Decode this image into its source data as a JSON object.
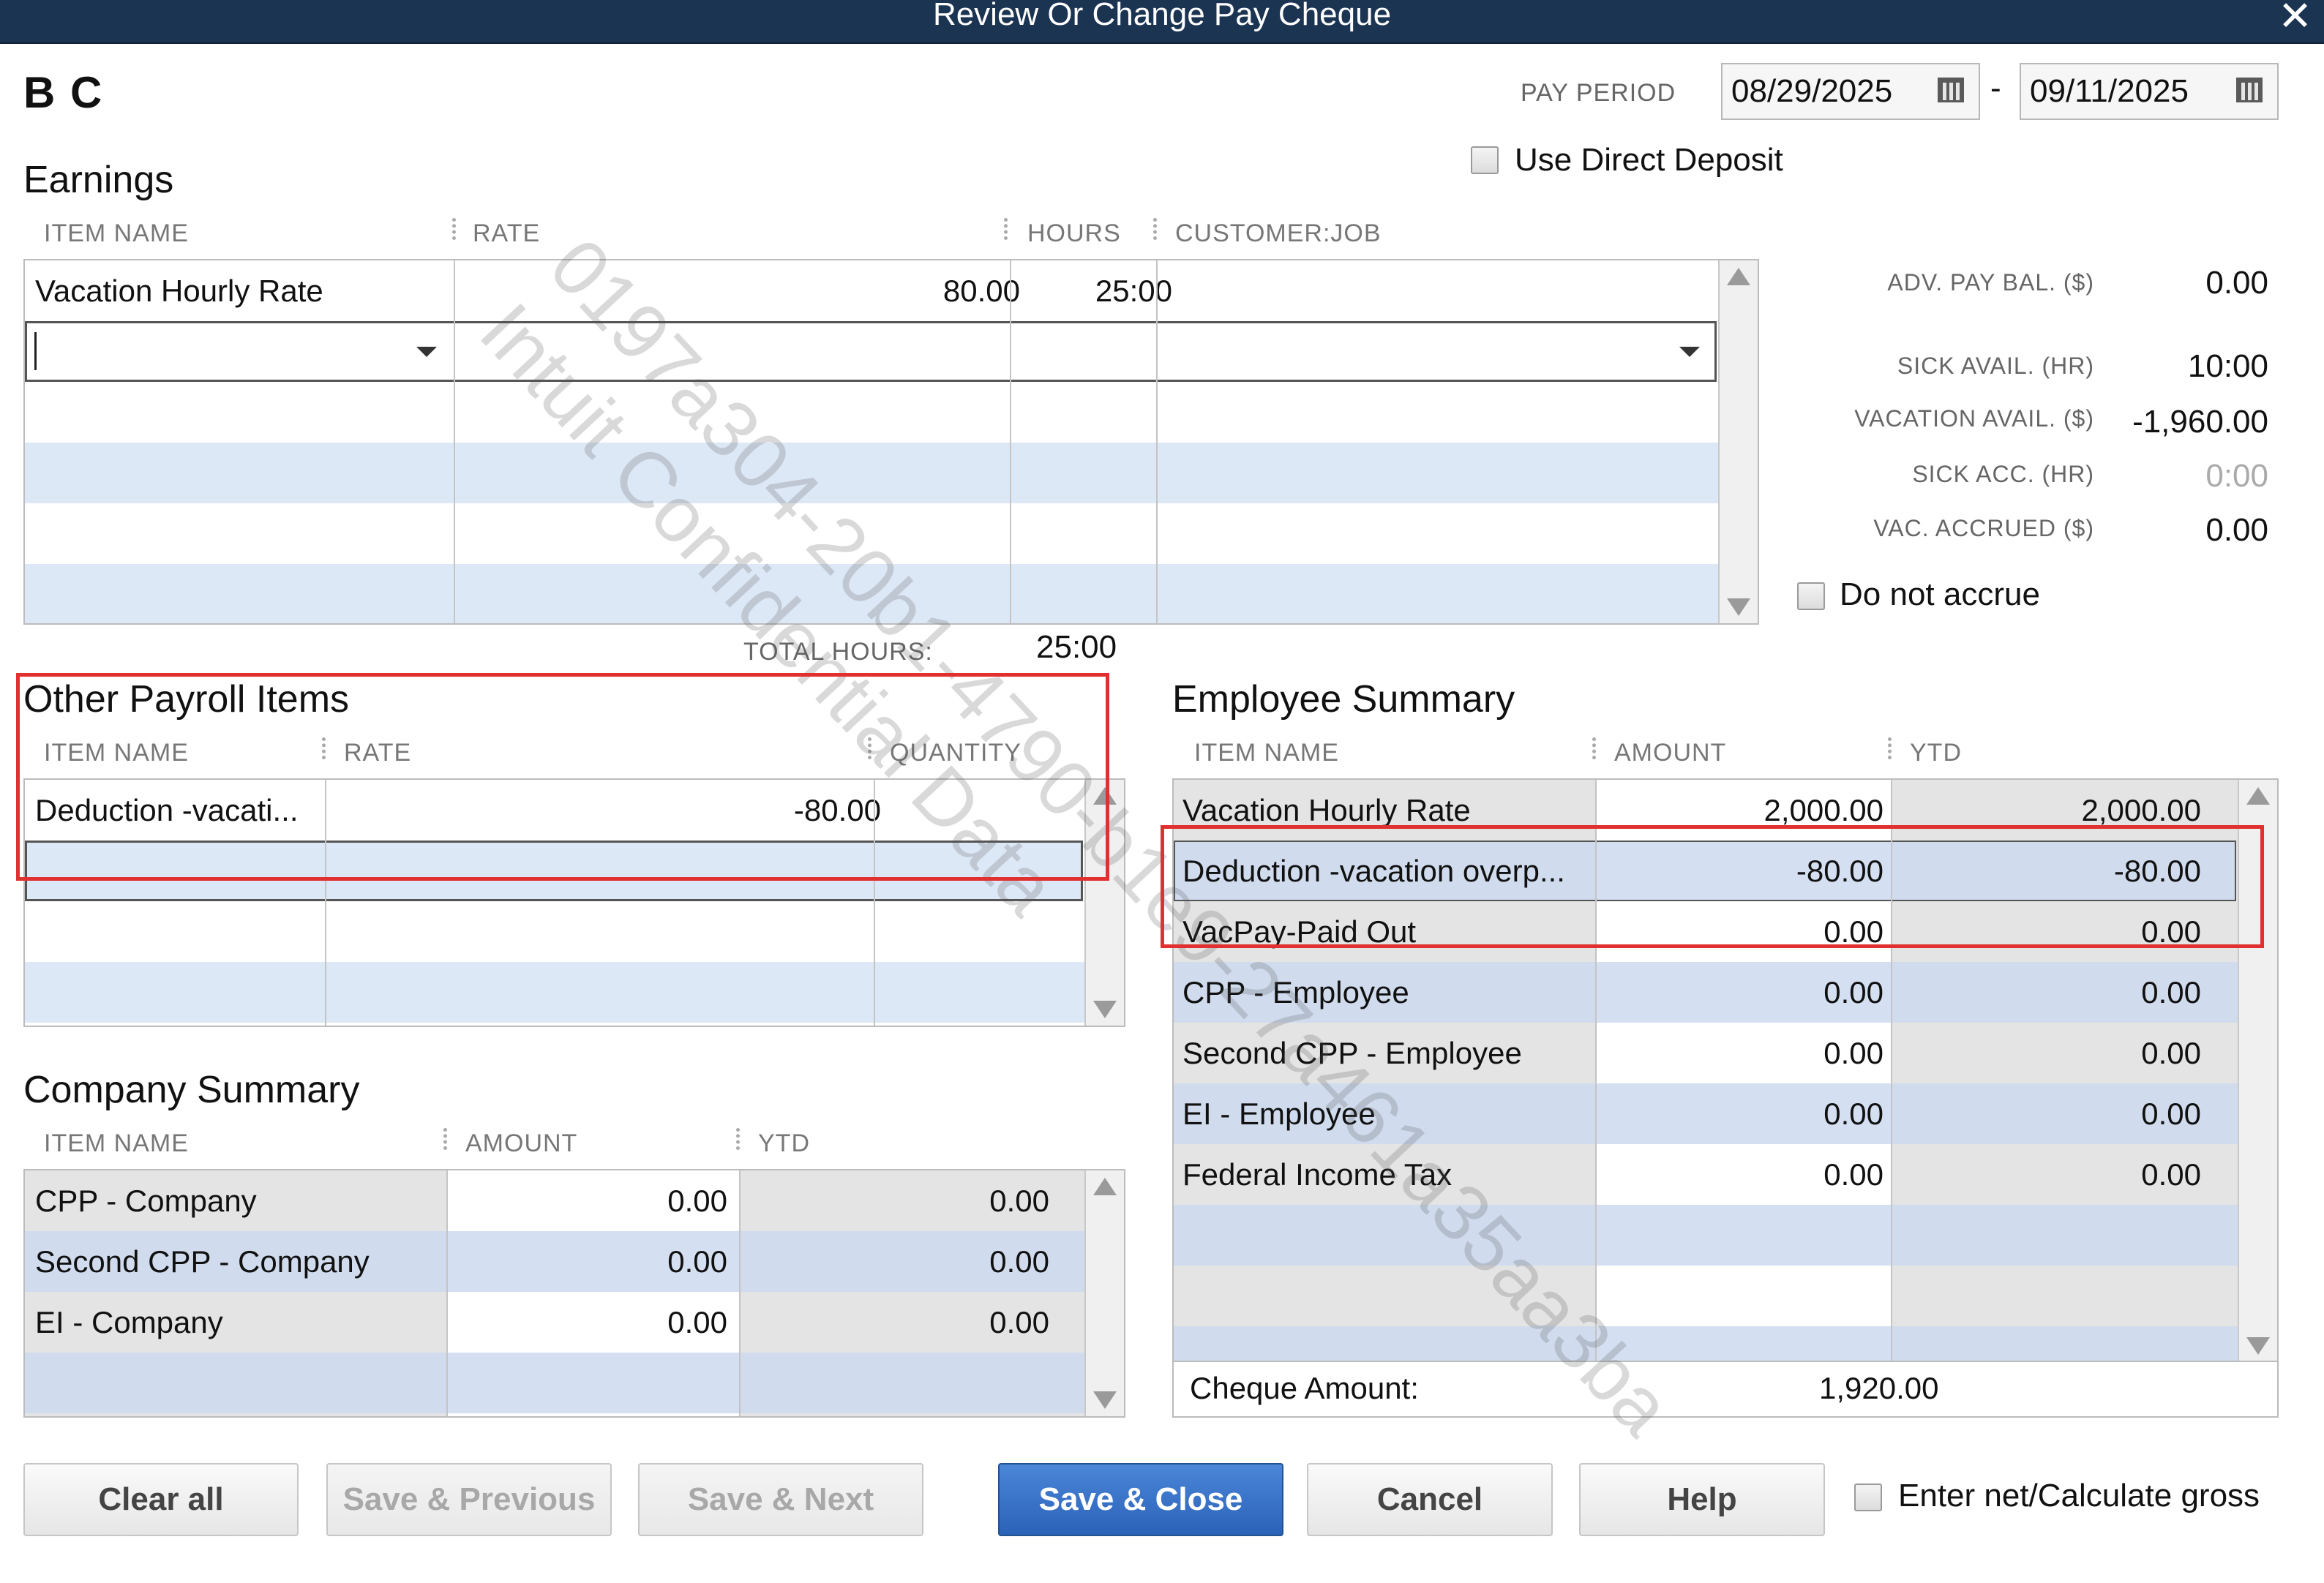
{
  "window": {
    "title": "Review Or Change Pay Cheque",
    "close": "✕"
  },
  "employee": {
    "name": "B C"
  },
  "pay_period": {
    "label": "PAY PERIOD",
    "start": "08/29/2025",
    "separator": "-",
    "end": "09/11/2025"
  },
  "direct_deposit": {
    "label": "Use Direct Deposit",
    "checked": false
  },
  "earnings": {
    "title": "Earnings",
    "columns": [
      "ITEM NAME",
      "RATE",
      "HOURS",
      "CUSTOMER:JOB"
    ],
    "rows": [
      {
        "item": "Vacation Hourly Rate",
        "rate": "80.00",
        "hours": "25:00",
        "job": ""
      }
    ],
    "total_hours_label": "TOTAL HOURS:",
    "total_hours": "25:00"
  },
  "balances": [
    {
      "label": "ADV. PAY BAL. ($)",
      "value": "0.00"
    },
    {
      "label": "SICK AVAIL. (HR)",
      "value": "10:00"
    },
    {
      "label": "VACATION AVAIL. ($)",
      "value": "-1,960.00"
    },
    {
      "label": "SICK ACC. (HR)",
      "value": "0:00"
    },
    {
      "label": "VAC. ACCRUED ($)",
      "value": "0.00"
    }
  ],
  "do_not_accrue": {
    "label": "Do not accrue",
    "checked": false
  },
  "other_payroll": {
    "title": "Other Payroll Items",
    "columns": [
      "ITEM NAME",
      "RATE",
      "QUANTITY"
    ],
    "rows": [
      {
        "item": "Deduction -vacati...",
        "rate": "-80.00",
        "quantity": ""
      }
    ]
  },
  "employee_summary": {
    "title": "Employee Summary",
    "columns": [
      "ITEM NAME",
      "AMOUNT",
      "YTD"
    ],
    "rows": [
      {
        "item": "Vacation Hourly Rate",
        "amount": "2,000.00",
        "ytd": "2,000.00"
      },
      {
        "item": "Deduction -vacation overp...",
        "amount": "-80.00",
        "ytd": "-80.00"
      },
      {
        "item": "VacPay-Paid Out",
        "amount": "0.00",
        "ytd": "0.00"
      },
      {
        "item": "CPP - Employee",
        "amount": "0.00",
        "ytd": "0.00"
      },
      {
        "item": "Second CPP - Employee",
        "amount": "0.00",
        "ytd": "0.00"
      },
      {
        "item": "EI - Employee",
        "amount": "0.00",
        "ytd": "0.00"
      },
      {
        "item": "Federal Income Tax",
        "amount": "0.00",
        "ytd": "0.00"
      }
    ],
    "cheque_amount_label": "Cheque Amount:",
    "cheque_amount": "1,920.00"
  },
  "company_summary": {
    "title": "Company Summary",
    "columns": [
      "ITEM NAME",
      "AMOUNT",
      "YTD"
    ],
    "rows": [
      {
        "item": "CPP - Company",
        "amount": "0.00",
        "ytd": "0.00"
      },
      {
        "item": "Second CPP - Company",
        "amount": "0.00",
        "ytd": "0.00"
      },
      {
        "item": "EI - Company",
        "amount": "0.00",
        "ytd": "0.00"
      }
    ]
  },
  "buttons": {
    "clear_all": "Clear all",
    "save_previous": "Save & Previous",
    "save_next": "Save & Next",
    "save_close": "Save & Close",
    "cancel": "Cancel",
    "help": "Help"
  },
  "net_gross": {
    "label": "Enter net/Calculate gross",
    "checked": false
  },
  "watermark": {
    "line1": "0197a304-20b1-4790-b1e9-27a461a35aa3ba",
    "line2": "Intuit Confidential Data"
  },
  "colors": {
    "titlebar": "#1b3452",
    "highlight": "#e03030",
    "row_alt": "#dde8f6",
    "primary": "#2a62b8"
  }
}
